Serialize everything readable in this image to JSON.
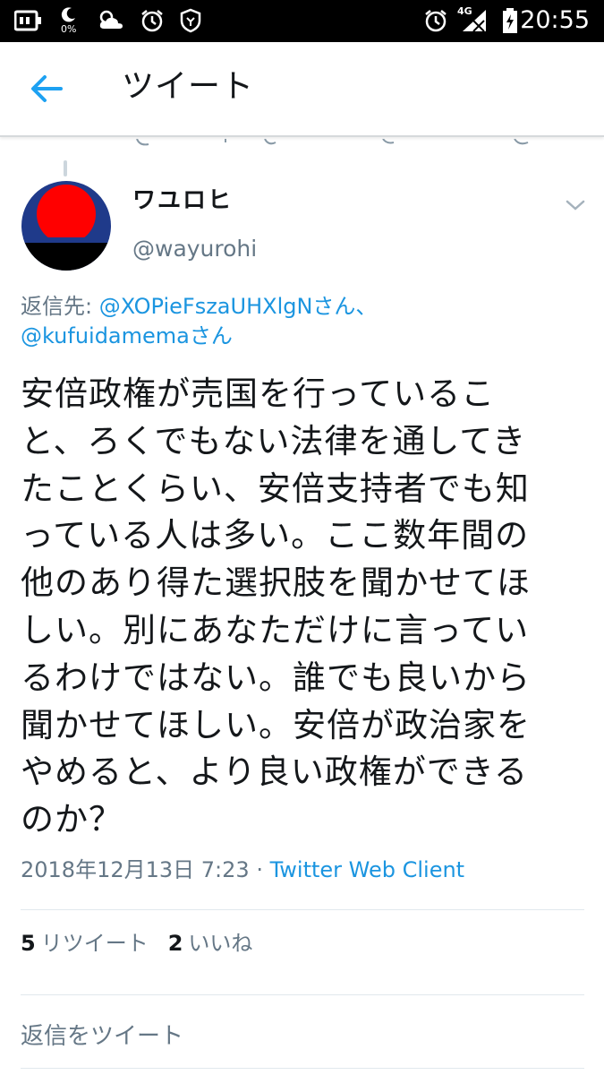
{
  "status_bar": {
    "battery_percent": "0%",
    "network": "4G",
    "time": "20:55"
  },
  "app_bar": {
    "back_icon": "arrow-left-icon",
    "title": "ツイート"
  },
  "tweet": {
    "author": {
      "display_name": "ワユロヒ",
      "handle": "@wayurohi"
    },
    "reply_to": {
      "prefix": "返信先: ",
      "user1": "@XOPieFszaUHXlgN",
      "suffix1": "さん、",
      "user2": "@kufuidamema",
      "suffix2": "さん"
    },
    "lines": [
      "安倍政権が売国を行っているこ",
      "と、ろくでもない法律を通してき",
      "たことくらい、安倍支持者でも知",
      "っている人は多い。ここ数年間の",
      "他のあり得た選択肢を聞かせてほ",
      "しい。別にあなただけに言ってい",
      "るわけではない。誰でも良いから",
      "聞かせてほしい。安倍が政治家を",
      "やめると、より良い政権ができる",
      "のか？"
    ],
    "timestamp": "2018年12月13日 7:23",
    "separator": " · ",
    "client": "Twitter Web Client",
    "retweet_count": "5",
    "retweet_label": "リツイート",
    "like_count": "2",
    "like_label": "いいね"
  },
  "reply": {
    "placeholder": "返信をツイート"
  },
  "colors": {
    "accent": "#1b95e0",
    "secondary_text": "#657786",
    "primary_text": "#14171a",
    "avatar_red": "#ff0000",
    "avatar_navy": "#1f3a8a"
  }
}
